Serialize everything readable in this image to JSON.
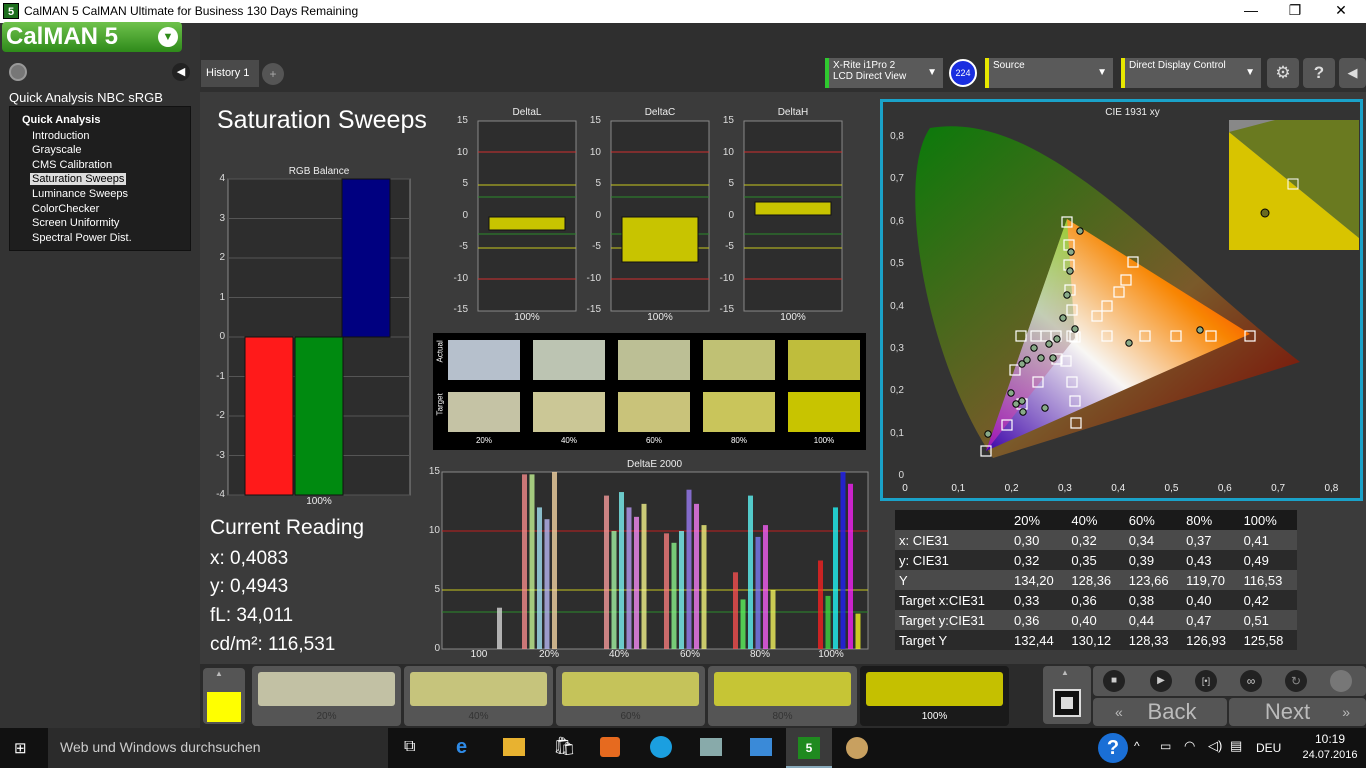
{
  "window": {
    "title": "CalMAN 5 CalMAN Ultimate for Business 130 Days Remaining",
    "app_icon": "5",
    "buttons": [
      "—",
      "❐",
      "✕"
    ]
  },
  "sidebar": {
    "logo": "CalMAN 5",
    "workflow_title": "Quick Analysis NBC sRGB",
    "root": "Quick Analysis",
    "items": [
      "Introduction",
      "Grayscale",
      "CMS Calibration",
      "Saturation Sweeps",
      "Luminance Sweeps",
      "ColorChecker",
      "Screen Uniformity",
      "Spectral Power Dist."
    ],
    "selected": "Saturation Sweeps"
  },
  "tabs": {
    "history": "History 1",
    "add": "+"
  },
  "devices": {
    "meter_line1": "X-Rite i1Pro 2",
    "meter_line2": "LCD Direct View",
    "meter_badge": "224",
    "source": "Source",
    "display": "Direct Display Control"
  },
  "page": {
    "title": "Saturation Sweeps"
  },
  "rgb_chart": {
    "title": "RGB Balance",
    "ticks": [
      "4",
      "3",
      "2",
      "1",
      "0",
      "-1",
      "-2",
      "-3",
      "-4"
    ],
    "xlabel": "100%"
  },
  "delta_charts": [
    {
      "title": "DeltaL",
      "xlabel": "100%"
    },
    {
      "title": "DeltaC",
      "xlabel": "100%"
    },
    {
      "title": "DeltaH",
      "xlabel": "100%"
    }
  ],
  "delta_ticks": [
    "15",
    "10",
    "5",
    "0",
    "-5",
    "-10",
    "-15"
  ],
  "swatches": {
    "actual_label": "Actual",
    "target_label": "Target",
    "levels": [
      "20%",
      "40%",
      "60%",
      "80%",
      "100%"
    ],
    "actual_colors": [
      "#b6c0cc",
      "#bcc4b2",
      "#bcbf95",
      "#c0c174",
      "#bfbd3c"
    ],
    "target_colors": [
      "#c5c3a5",
      "#cbc796",
      "#c9c37a",
      "#c9c55b",
      "#c8c400"
    ]
  },
  "deltae_chart": {
    "title": "DeltaE 2000",
    "ticks": [
      "15",
      "10",
      "5",
      "0"
    ],
    "xlabels": [
      "100",
      "20%",
      "40%",
      "60%",
      "80%",
      "100%"
    ]
  },
  "cie": {
    "title": "CIE 1931 xy",
    "yticks": [
      "0,8",
      "0,7",
      "0,6",
      "0,5",
      "0,4",
      "0,3",
      "0,2",
      "0,1",
      "0"
    ],
    "xticks": [
      "0",
      "0,1",
      "0,2",
      "0,3",
      "0,4",
      "0,5",
      "0,6",
      "0,7",
      "0,8"
    ]
  },
  "reading": {
    "title": "Current Reading",
    "x": "x: 0,4083",
    "y": "y: 0,4943",
    "fl": "fL: 34,011",
    "cdm2": "cd/m²: 116,531"
  },
  "table": {
    "headers": [
      "20%",
      "40%",
      "60%",
      "80%",
      "100%"
    ],
    "rows": [
      {
        "label": "x: CIE31",
        "values": [
          "0,30",
          "0,32",
          "0,34",
          "0,37",
          "0,41"
        ]
      },
      {
        "label": "y: CIE31",
        "values": [
          "0,32",
          "0,35",
          "0,39",
          "0,43",
          "0,49"
        ]
      },
      {
        "label": "Y",
        "values": [
          "134,20",
          "128,36",
          "123,66",
          "119,70",
          "116,53"
        ]
      },
      {
        "label": "Target x:CIE31",
        "values": [
          "0,33",
          "0,36",
          "0,38",
          "0,40",
          "0,42"
        ]
      },
      {
        "label": "Target y:CIE31",
        "values": [
          "0,36",
          "0,40",
          "0,44",
          "0,47",
          "0,51"
        ]
      },
      {
        "label": "Target Y",
        "values": [
          "132,44",
          "130,12",
          "128,33",
          "126,93",
          "125,58"
        ]
      }
    ]
  },
  "bottom": {
    "steps": [
      "20%",
      "40%",
      "60%",
      "80%",
      "100%"
    ],
    "step_colors": [
      "#c2c1a4",
      "#c6c47c",
      "#c5c35a",
      "#c6c535",
      "#c5c000"
    ],
    "back": "Back",
    "next": "Next"
  },
  "taskbar": {
    "search": "Web und Windows durchsuchen",
    "lang": "DEU",
    "time": "10:19",
    "date": "24.07.2016"
  }
}
